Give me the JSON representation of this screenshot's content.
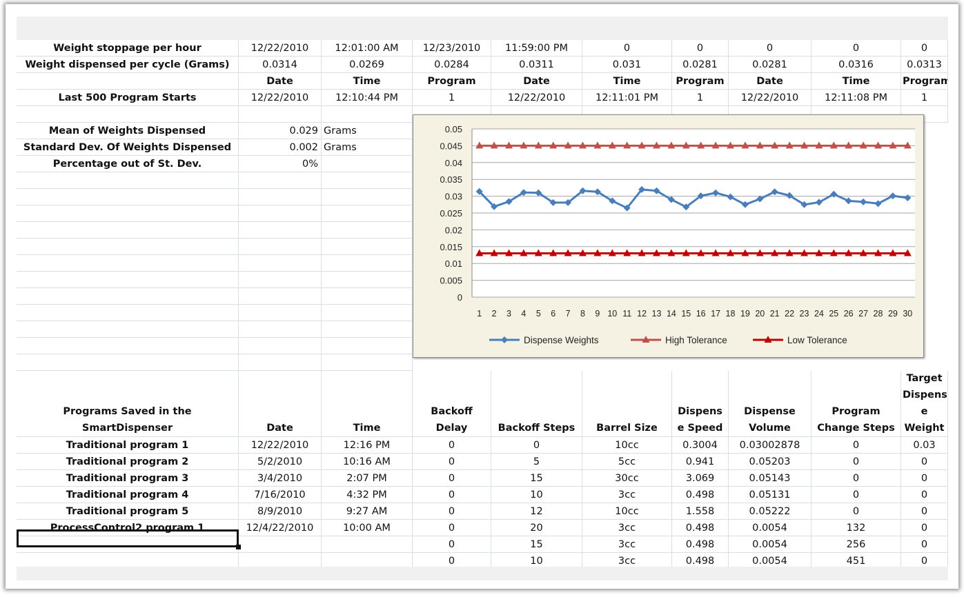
{
  "top_rows": {
    "row1": [
      "Weight stoppage per hour",
      "12/22/2010",
      "12:01:00 AM",
      "12/23/2010",
      "11:59:00 PM",
      "0",
      "0",
      "0",
      "0",
      "0"
    ],
    "row2": [
      "Weight dispensed per cycle (Grams)",
      "0.0314",
      "0.0269",
      "0.0284",
      "0.0311",
      "0.031",
      "0.0281",
      "0.0281",
      "0.0316",
      "0.0313"
    ],
    "row3": [
      "",
      "Date",
      "Time",
      "Program",
      "Date",
      "Time",
      "Program",
      "Date",
      "Time",
      "Program"
    ],
    "row4": [
      "Last 500 Program Starts",
      "12/22/2010",
      "12:10:44 PM",
      "1",
      "12/22/2010",
      "12:11:01 PM",
      "1",
      "12/22/2010",
      "12:11:08 PM",
      "1"
    ]
  },
  "stats": [
    {
      "label": "Mean of Weights Dispensed",
      "value": "0.029",
      "unit": "Grams"
    },
    {
      "label": "Standard Dev. Of Weights Dispensed",
      "value": "0.002",
      "unit": "Grams"
    },
    {
      "label": "Percentage out of St. Dev.",
      "value": "0%",
      "unit": ""
    }
  ],
  "programs": {
    "headers": [
      [
        "Programs Saved in the",
        "SmartDispenser"
      ],
      [
        "Date"
      ],
      [
        "Time"
      ],
      [
        "Backoff",
        "Delay"
      ],
      [
        "Backoff Steps"
      ],
      [
        "Barrel Size"
      ],
      [
        "Dispens",
        "e Speed"
      ],
      [
        "Dispense",
        "Volume"
      ],
      [
        "Program",
        "Change Steps"
      ],
      [
        "Target",
        "Dispens",
        "e",
        "Weight"
      ]
    ],
    "rows": [
      [
        "Traditional program 1",
        "12/22/2010",
        "12:16 PM",
        "0",
        "0",
        "10cc",
        "0.3004",
        "0.03002878",
        "0",
        "0.03"
      ],
      [
        "Traditional program 2",
        "5/2/2010",
        "10:16 AM",
        "0",
        "5",
        "5cc",
        "0.941",
        "0.05203",
        "0",
        "0"
      ],
      [
        "Traditional program 3",
        "3/4/2010",
        "2:07 PM",
        "0",
        "15",
        "30cc",
        "3.069",
        "0.05143",
        "0",
        "0"
      ],
      [
        "Traditional program 4",
        "7/16/2010",
        "4:32 PM",
        "0",
        "10",
        "3cc",
        "0.498",
        "0.05131",
        "0",
        "0"
      ],
      [
        "Traditional program 5",
        "8/9/2010",
        "9:27 AM",
        "0",
        "12",
        "10cc",
        "1.558",
        "0.05222",
        "0",
        "0"
      ],
      [
        "ProcessControl2 program 1",
        "12/4/22/2010",
        "10:00 AM",
        "0",
        "20",
        "3cc",
        "0.498",
        "0.0054",
        "132",
        "0"
      ],
      [
        "",
        "",
        "",
        "0",
        "15",
        "3cc",
        "0.498",
        "0.0054",
        "256",
        "0"
      ],
      [
        "",
        "",
        "",
        "0",
        "10",
        "3cc",
        "0.498",
        "0.0054",
        "451",
        "0"
      ]
    ]
  },
  "chart_data": {
    "type": "line",
    "x": [
      1,
      2,
      3,
      4,
      5,
      6,
      7,
      8,
      9,
      10,
      11,
      12,
      13,
      14,
      15,
      16,
      17,
      18,
      19,
      20,
      21,
      22,
      23,
      24,
      25,
      26,
      27,
      28,
      29,
      30
    ],
    "ylim": [
      0,
      0.05
    ],
    "yticks": [
      "0",
      "0.005",
      "0.01",
      "0.015",
      "0.02",
      "0.025",
      "0.03",
      "0.035",
      "0.04",
      "0.045",
      "0.05"
    ],
    "legend_position": "bottom",
    "grid": true,
    "series": [
      {
        "name": "Dispense Weights",
        "color": "#4a7ebb",
        "marker": "diamond",
        "values": [
          0.0314,
          0.0269,
          0.0284,
          0.0311,
          0.031,
          0.0281,
          0.0281,
          0.0316,
          0.0313,
          0.0286,
          0.0265,
          0.032,
          0.0316,
          0.029,
          0.0268,
          0.0301,
          0.031,
          0.0298,
          0.0275,
          0.0292,
          0.0313,
          0.0302,
          0.0275,
          0.0282,
          0.0306,
          0.0286,
          0.0283,
          0.0278,
          0.0301,
          0.0295
        ]
      },
      {
        "name": "High Tolerance",
        "color": "#c0504d",
        "marker": "triangle",
        "values": [
          0.045,
          0.045,
          0.045,
          0.045,
          0.045,
          0.045,
          0.045,
          0.045,
          0.045,
          0.045,
          0.045,
          0.045,
          0.045,
          0.045,
          0.045,
          0.045,
          0.045,
          0.045,
          0.045,
          0.045,
          0.045,
          0.045,
          0.045,
          0.045,
          0.045,
          0.045,
          0.045,
          0.045,
          0.045,
          0.045
        ]
      },
      {
        "name": "Low Tolerance",
        "color": "#c00000",
        "marker": "triangle",
        "values": [
          0.013,
          0.013,
          0.013,
          0.013,
          0.013,
          0.013,
          0.013,
          0.013,
          0.013,
          0.013,
          0.013,
          0.013,
          0.013,
          0.013,
          0.013,
          0.013,
          0.013,
          0.013,
          0.013,
          0.013,
          0.013,
          0.013,
          0.013,
          0.013,
          0.013,
          0.013,
          0.013,
          0.013,
          0.013,
          0.013
        ]
      }
    ]
  }
}
